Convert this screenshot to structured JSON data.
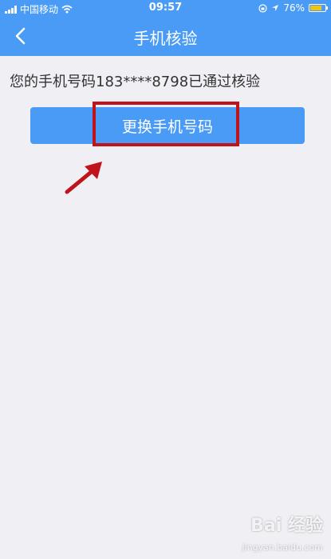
{
  "status_bar": {
    "carrier": "中国移动",
    "time": "09:57",
    "battery": "76%",
    "battery_level": 0.76,
    "battery_color": "#f5c400"
  },
  "nav": {
    "title": "手机核验",
    "back_icon": "chevron-left-icon"
  },
  "main": {
    "status_text": "您的手机号码183****8798已通过核验",
    "change_button_label": "更换手机号码"
  },
  "annotation": {
    "highlight_color": "#c0141c"
  },
  "watermark": {
    "text": "Bai 经验",
    "sub": "jingyan.baidu.com"
  },
  "colors": {
    "accent": "#4a9bf5",
    "background": "#efeff4"
  }
}
